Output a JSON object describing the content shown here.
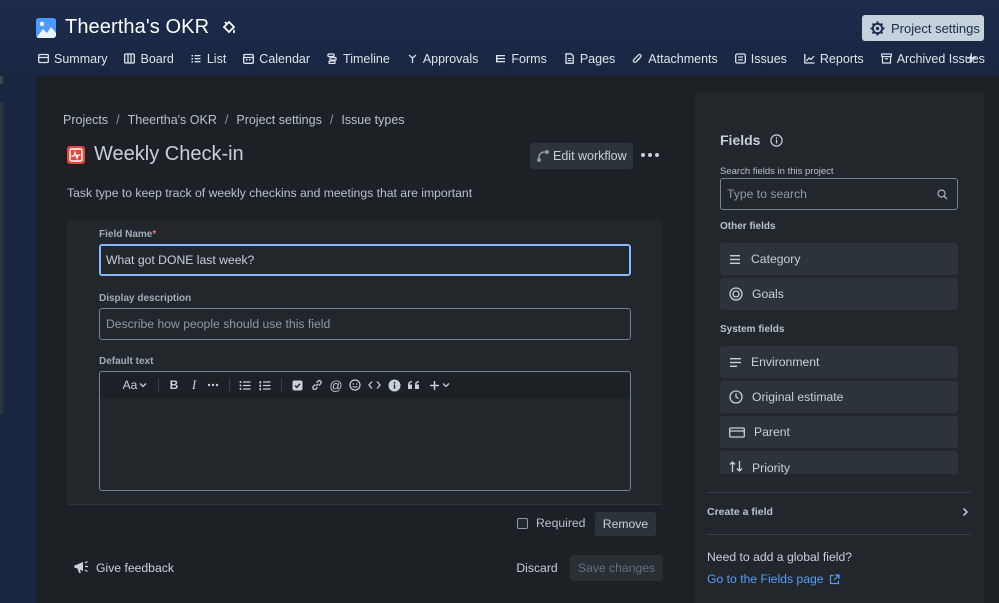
{
  "header": {
    "project_title": "Theertha's OKR",
    "settings_button": "Project settings",
    "nav": [
      {
        "label": "Summary",
        "icon": "summary-icon"
      },
      {
        "label": "Board",
        "icon": "board-icon"
      },
      {
        "label": "List",
        "icon": "list-icon"
      },
      {
        "label": "Calendar",
        "icon": "calendar-icon"
      },
      {
        "label": "Timeline",
        "icon": "timeline-icon"
      },
      {
        "label": "Approvals",
        "icon": "approvals-icon"
      },
      {
        "label": "Forms",
        "icon": "forms-icon"
      },
      {
        "label": "Pages",
        "icon": "pages-icon"
      },
      {
        "label": "Attachments",
        "icon": "attachments-icon"
      },
      {
        "label": "Issues",
        "icon": "issues-icon"
      },
      {
        "label": "Reports",
        "icon": "reports-icon"
      },
      {
        "label": "Archived Issues",
        "icon": "archive-icon"
      }
    ],
    "add_tab": "+"
  },
  "breadcrumb": [
    "Projects",
    "Theertha's OKR",
    "Project settings",
    "Issue types"
  ],
  "breadcrumb_sep": "/",
  "issue_type": {
    "title": "Weekly Check-in",
    "edit_workflow": "Edit workflow",
    "description": "Task type to keep track of weekly checkins and meetings that are important"
  },
  "field_editor": {
    "field_name_label": "Field Name",
    "required_mark": "*",
    "field_name_value": "What got DONE last week?",
    "display_description_label": "Display description",
    "display_description_placeholder": "Describe how people should use this field",
    "default_text_label": "Default text",
    "toolbar": {
      "text_style": "Aa"
    },
    "required_label": "Required",
    "required_checked": false,
    "remove_button": "Remove"
  },
  "footer": {
    "feedback": "Give feedback",
    "discard": "Discard",
    "save": "Save changes"
  },
  "fields_panel": {
    "title": "Fields",
    "search_label": "Search fields in this project",
    "search_placeholder": "Type to search",
    "other_heading": "Other fields",
    "other_fields": [
      {
        "label": "Category",
        "icon": "lines-icon"
      },
      {
        "label": "Goals",
        "icon": "target-icon"
      }
    ],
    "system_heading": "System fields",
    "system_fields": [
      {
        "label": "Environment",
        "icon": "text-lines-icon"
      },
      {
        "label": "Original estimate",
        "icon": "clock-icon"
      },
      {
        "label": "Parent",
        "icon": "parent-icon"
      },
      {
        "label": "Priority",
        "icon": "priority-icon"
      }
    ],
    "create_field": "Create a field",
    "need_global": "Need to add a global field?",
    "goto_fields": "Go to the Fields page"
  },
  "colors": {
    "accent": "#579dff",
    "focus_border": "#85b8ff",
    "issue_icon": "#e2483d",
    "header_bg": "#1c2b4d"
  }
}
